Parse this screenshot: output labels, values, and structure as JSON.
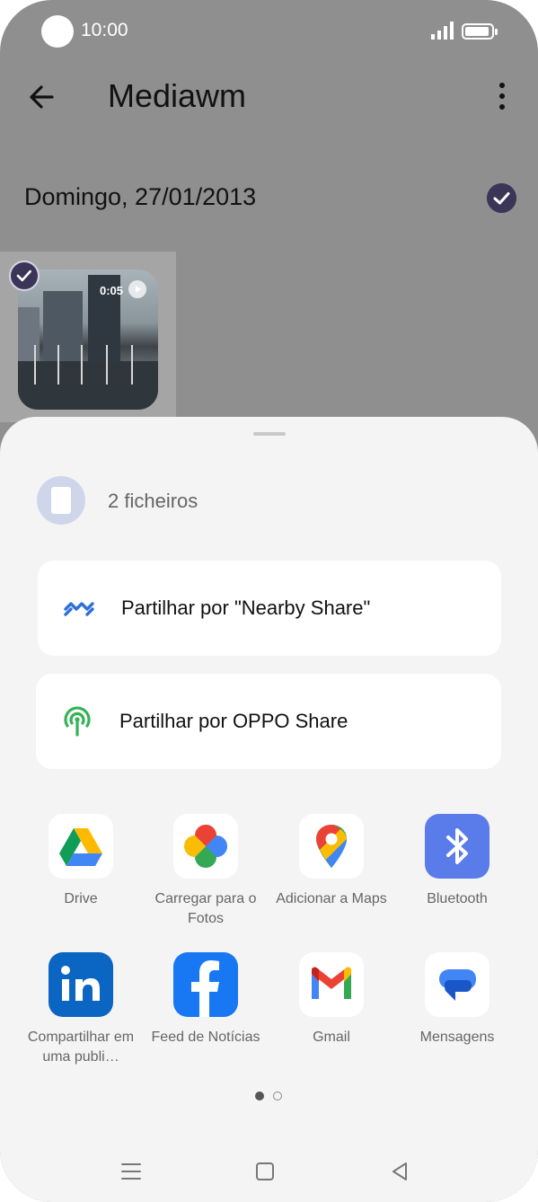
{
  "status_bar": {
    "time": "10:00"
  },
  "app_bar": {
    "title": "Mediawm"
  },
  "gallery": {
    "date_label": "Domingo, 27/01/2013",
    "items": [
      {
        "duration": "0:05",
        "selected": true
      }
    ]
  },
  "share_sheet": {
    "file_count": "2 ficheiros",
    "options": [
      {
        "label": "Partilhar por \"Nearby Share\"",
        "icon": "nearby-share-icon"
      },
      {
        "label": "Partilhar por OPPO Share",
        "icon": "oppo-share-icon"
      }
    ],
    "apps": [
      {
        "label": "Drive",
        "icon": "google-drive-icon"
      },
      {
        "label": "Carregar para o Fotos",
        "icon": "google-photos-icon"
      },
      {
        "label": "Adicionar a Maps",
        "icon": "google-maps-icon"
      },
      {
        "label": "Bluetooth",
        "icon": "bluetooth-icon"
      },
      {
        "label": "Compartilhar em uma publi…",
        "icon": "linkedin-icon"
      },
      {
        "label": "Feed de Notícias",
        "icon": "facebook-icon"
      },
      {
        "label": "Gmail",
        "icon": "gmail-icon"
      },
      {
        "label": "Mensagens",
        "icon": "messages-icon"
      }
    ],
    "page": {
      "current": 1,
      "total": 2
    }
  },
  "colors": {
    "scrim": "#8f8f8f",
    "sheet_background": "#f4f4f4",
    "check_accent": "#3b3558",
    "nearby_blue": "#2f6fdb",
    "oppo_green": "#34b255"
  }
}
